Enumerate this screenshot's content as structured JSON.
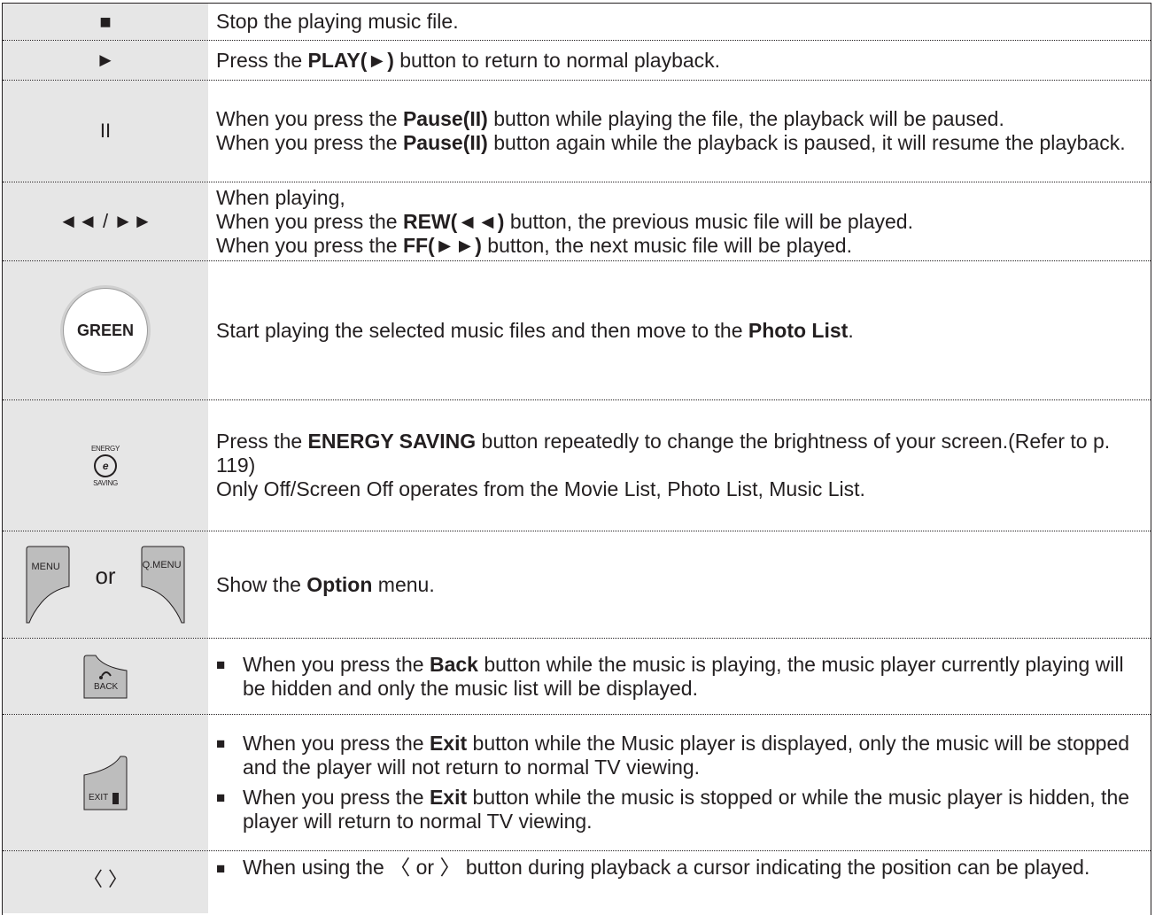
{
  "rows": [
    {
      "icon": "■",
      "text": "Stop the playing music file."
    },
    {
      "icon": "►",
      "pre": "Press the ",
      "bold": "PLAY(►)",
      "post": " button to return to normal playback."
    },
    {
      "icon": "II",
      "p1_pre": "When you press the ",
      "p1_bold": "Pause(II)",
      "p1_post": " button while playing the file, the playback will be paused.",
      "p2_pre": "When you press the ",
      "p2_bold": "Pause(II)",
      "p2_post": " button again while the playback is paused, it will resume the playback."
    },
    {
      "icon": "◄◄ / ►►",
      "line1": "When playing,",
      "l2_pre": "When you press the ",
      "l2_bold": "REW(◄◄)",
      "l2_post": " button, the previous music file will be played.",
      "l3_pre": "When you press the ",
      "l3_bold": "FF(►►)",
      "l3_post": " button, the next music file will be played."
    },
    {
      "icon_label": "GREEN",
      "pre": "Start playing the selected music files and then move to the ",
      "bold": "Photo List",
      "post": "."
    },
    {
      "icon_top": "ENERGY",
      "icon_bottom": "SAVING",
      "pre": "Press the ",
      "bold": "ENERGY SAVING",
      "post": " button repeatedly to change the brightness of your screen.(Refer to p. 119)",
      "line2": "Only Off/Screen Off operates from the Movie List, Photo List, Music List."
    },
    {
      "key1": "MENU",
      "or_word": "or",
      "key2": "Q.MENU",
      "pre": "Show the ",
      "bold": "Option",
      "post": " menu."
    },
    {
      "icon_label": "BACK",
      "bullet": "■",
      "pre": "When you press the ",
      "bold": "Back",
      "post": " button while the music is playing, the music player currently playing will be hidden and only the music list will be displayed."
    },
    {
      "icon_label": "EXIT",
      "bullet": "■",
      "b1_pre": "When you press the ",
      "b1_bold": "Exit",
      "b1_post": " button while the Music player is displayed, only the music will be stopped and the player will not return to normal TV viewing.",
      "b2_pre": "When you press the ",
      "b2_bold": "Exit",
      "b2_post": " button while the music is stopped or while the music player is hidden, the player will return to normal TV viewing."
    },
    {
      "icon": "〈 〉",
      "bullet": "■",
      "text": "When using the 〈 or 〉 button during playback a cursor indicating the position can be played."
    }
  ]
}
